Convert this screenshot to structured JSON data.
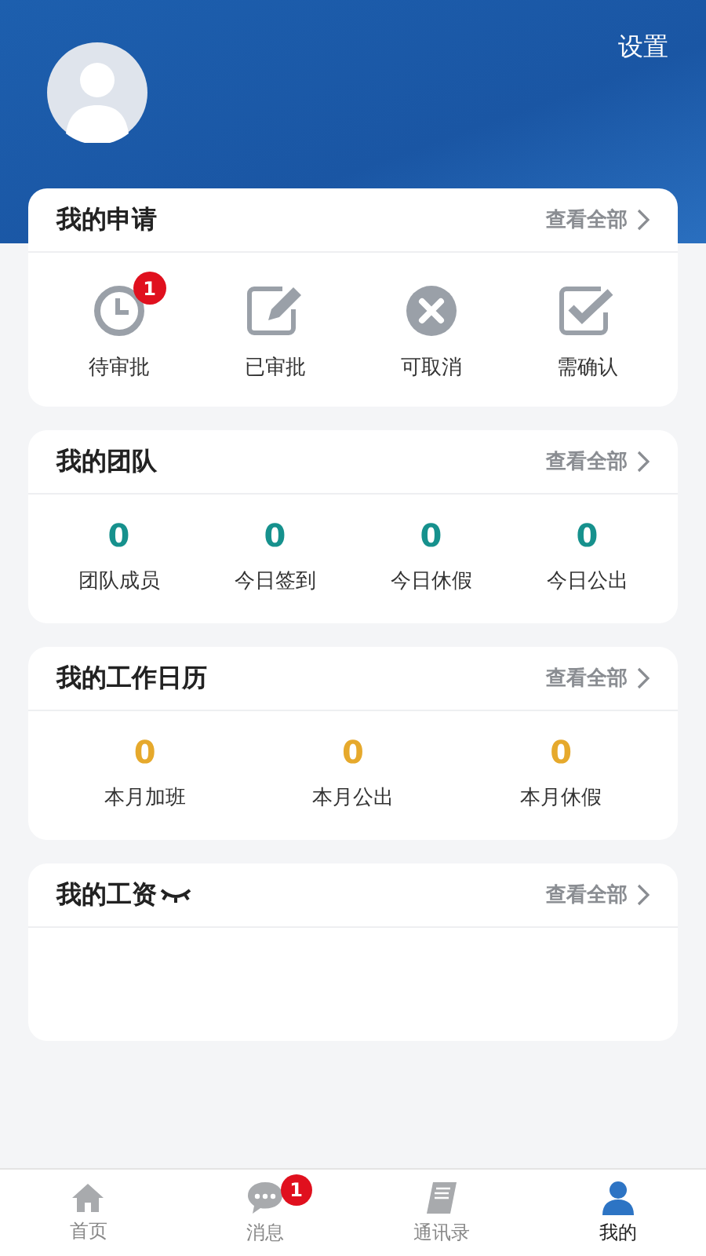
{
  "header": {
    "settings": "设置"
  },
  "sections": [
    {
      "kind": "actions",
      "title": "我的申请",
      "link": "查看全部",
      "items": [
        {
          "kind": "clock",
          "label": "待审批",
          "badge": "1"
        },
        {
          "kind": "edit",
          "label": "已审批"
        },
        {
          "kind": "cancel",
          "label": "可取消"
        },
        {
          "kind": "check",
          "label": "需确认"
        }
      ]
    },
    {
      "kind": "stats",
      "title": "我的团队",
      "link": "查看全部",
      "color": "#16918d",
      "items": [
        {
          "value": "0",
          "label": "团队成员"
        },
        {
          "value": "0",
          "label": "今日签到"
        },
        {
          "value": "0",
          "label": "今日休假"
        },
        {
          "value": "0",
          "label": "今日公出"
        }
      ]
    },
    {
      "kind": "stats",
      "title": "我的工作日历",
      "link": "查看全部",
      "color": "#e6a92c",
      "items": [
        {
          "value": "0",
          "label": "本月加班"
        },
        {
          "value": "0",
          "label": "本月公出"
        },
        {
          "value": "0",
          "label": "本月休假"
        }
      ]
    },
    {
      "kind": "salary",
      "title": "我的工资",
      "link": "查看全部"
    }
  ],
  "tabs": [
    {
      "kind": "home",
      "label": "首页",
      "selected": false
    },
    {
      "kind": "chat",
      "label": "消息",
      "selected": false,
      "badge": "1"
    },
    {
      "kind": "book",
      "label": "通讯录",
      "selected": false
    },
    {
      "kind": "person",
      "label": "我的",
      "selected": true
    }
  ]
}
